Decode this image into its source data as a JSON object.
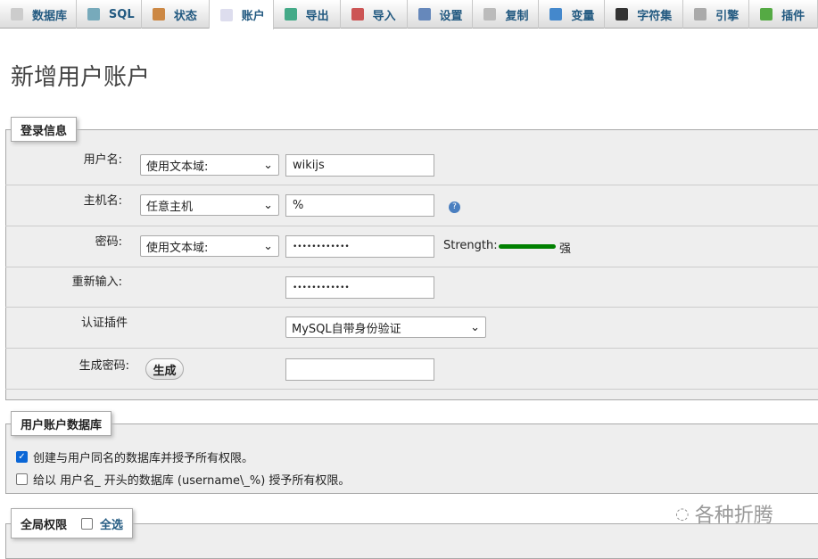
{
  "tabs": [
    {
      "label": "数据库",
      "icon": "database-icon"
    },
    {
      "label": "SQL",
      "icon": "sql-icon"
    },
    {
      "label": "状态",
      "icon": "status-icon"
    },
    {
      "label": "账户",
      "icon": "accounts-icon",
      "active": true
    },
    {
      "label": "导出",
      "icon": "export-icon"
    },
    {
      "label": "导入",
      "icon": "import-icon"
    },
    {
      "label": "设置",
      "icon": "wrench-icon"
    },
    {
      "label": "复制",
      "icon": "replication-icon"
    },
    {
      "label": "变量",
      "icon": "variables-icon"
    },
    {
      "label": "字符集",
      "icon": "charset-icon"
    },
    {
      "label": "引擎",
      "icon": "engine-icon"
    },
    {
      "label": "插件",
      "icon": "plugin-icon"
    }
  ],
  "page_title": "新增用户账户",
  "login": {
    "legend": "登录信息",
    "username_label": "用户名:",
    "username_type": "使用文本域:",
    "username_value": "wikijs",
    "host_label": "主机名:",
    "host_type": "任意主机",
    "host_value": "%",
    "password_label": "密码:",
    "password_type": "使用文本域:",
    "password_value": "••••••••••••",
    "strength_label": "Strength:",
    "strength_text": "强",
    "strength_percent": 100,
    "strength_color": "#008000",
    "retype_label": "重新输入:",
    "retype_value": "••••••••••••",
    "auth_label": "认证插件",
    "auth_value": "MySQL自带身份验证",
    "generate_label": "生成密码:",
    "generate_button": "生成",
    "generate_value": ""
  },
  "database": {
    "legend": "用户账户数据库",
    "option1": "创建与用户同名的数据库并授予所有权限。",
    "option1_checked": true,
    "option2": "给以 用户名_ 开头的数据库 (username\\_%) 授予所有权限。",
    "option2_checked": false
  },
  "global": {
    "legend": "全局权限",
    "select_all": "全选",
    "select_all_checked": false
  },
  "watermark": "各种折腾"
}
